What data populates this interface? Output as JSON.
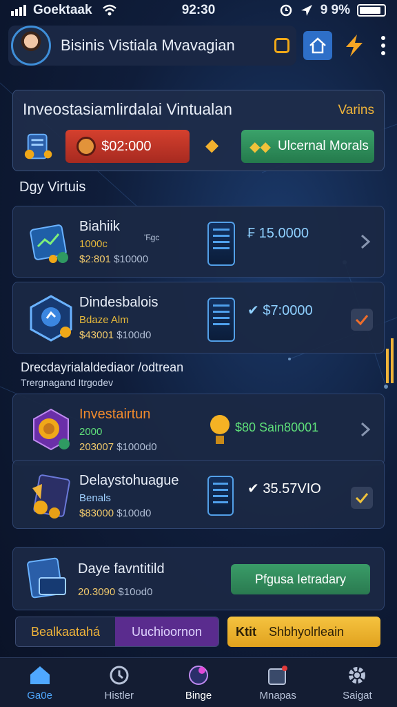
{
  "status_bar": {
    "carrier": "Goektaak",
    "time": "92:30",
    "battery": "9 9%"
  },
  "header": {
    "title": "Bisinis Vistiala Mvavagian"
  },
  "invest_card": {
    "title": "Inveostasiamlirdalai Vintualan",
    "link": "Varins",
    "balance": "$02:000",
    "alt_button": "Ulcernal Morals"
  },
  "section_label": "Dgy Virtuis",
  "items": [
    {
      "title": "Biahiik",
      "tag": "'F̵gc",
      "sub": "1000c",
      "meta_value": "$2:801",
      "meta_muted": "$10000",
      "amount": "₣ 15.0000",
      "amount_color": "#8fd0ff",
      "right": "chevron"
    },
    {
      "title": "Dindesbalois",
      "tag": "",
      "sub": "Bdaze Alm",
      "meta_value": "$43001",
      "meta_muted": "$100d0",
      "amount": "✔ $7:0000",
      "amount_color": "#8fd0ff",
      "right": "check-orange"
    },
    {
      "title": "Investairtun",
      "tag": "",
      "sub": "2000",
      "meta_value": "203007",
      "meta_muted": "$1000d0",
      "amount": "$80 Sain80001",
      "amount_color": "#5fe07a",
      "right": "chevron"
    },
    {
      "title": "Delaystohuague",
      "tag": "",
      "sub": "Benals",
      "meta_value": "$83000",
      "meta_muted": "$100d0",
      "amount": "✔ 35.57VIO",
      "amount_color": "#ffffff",
      "right": "check-yellow"
    }
  ],
  "sub_section": {
    "label": "Drecdayrialaldediaor /odtrean",
    "sub": "Trergnagand Itrgodev"
  },
  "daily": {
    "title": "Daye favntitild",
    "value": "20.3090",
    "muted": "$10od0",
    "button": "Pfgusa Ietradary"
  },
  "bottom_buttons": {
    "left_a": "Bealkaatahá",
    "left_b": "Uuchioornon",
    "gold_prefix": "Ktit",
    "gold_label": "Shbhyolrleain"
  },
  "nav": [
    {
      "label": "Ga0e",
      "icon": "home-icon",
      "active": true
    },
    {
      "label": "Histler",
      "icon": "history-icon",
      "active": false
    },
    {
      "label": "Binge",
      "icon": "bulb-icon",
      "active": false
    },
    {
      "label": "Mnapas",
      "icon": "briefcase-icon",
      "active": false
    },
    {
      "label": "Saigat",
      "icon": "gear-icon",
      "active": false
    }
  ],
  "colors": {
    "accent_blue": "#2e6fc8",
    "accent_red": "#c7382a",
    "accent_green": "#2f9a62",
    "accent_gold": "#f0b43a",
    "accent_purple": "#5a2c8e"
  }
}
